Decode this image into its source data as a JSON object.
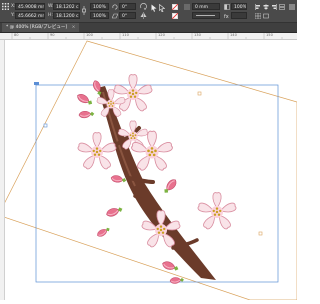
{
  "toolbar": {
    "x_field": "45.9008 mm",
    "y_field": "45.6662 mm",
    "w_field": "18.1202 c",
    "h_field": "18.1200 c",
    "scale_x": "100%",
    "scale_y": "100%",
    "rotate_field": "0°",
    "shear_field": "0°",
    "stroke_weight": "0 mm",
    "opacity": "100%"
  },
  "document_tab": {
    "title": "* @ 400% [RGB/プレビュー]"
  },
  "ruler": {
    "labels": [
      "80",
      "90",
      "100",
      "110",
      "120",
      "130",
      "140",
      "150"
    ]
  },
  "colors": {
    "toolbar_bg": "#4a4a4a",
    "selection_frame": "#5b8fd6",
    "rotated_frame": "#d9a25c",
    "petal": "#f7d9e0",
    "petal_edge": "#d98ea0",
    "bud": "#e06a88",
    "branch": "#6b3b2a"
  }
}
